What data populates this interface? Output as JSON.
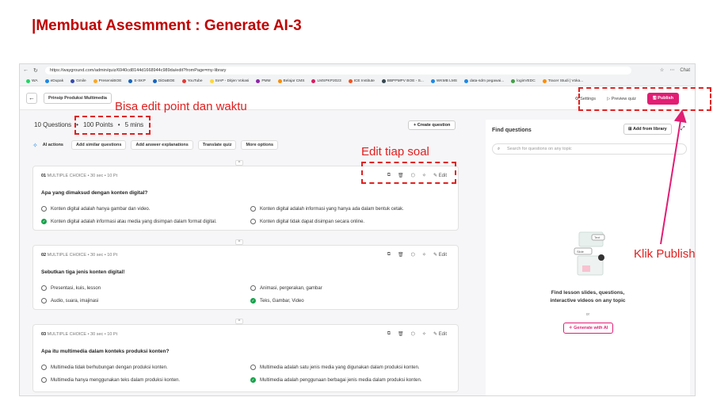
{
  "slide": {
    "title": "|Membuat Asesmment : Generate AI-3"
  },
  "browser": {
    "url": "https://wayground.com/admin/quiz/6940cd8144d1668944c989da/edit?fromPage=my-library",
    "profile_label": "Chat",
    "bookmarks": [
      "WA",
      "eDupak",
      "Gmile",
      "PresensiBOE",
      "E-SKP",
      "DiDaBOE",
      "YouTube",
      "SIAP - Ditjen Vokasi",
      "PMM",
      "Belajar CMS",
      "LMSPKP2023",
      "ICE Institute",
      "BBPPMPV BOE - S...",
      "WKMB LMS",
      "data-sdm pegawai...",
      "loginVEDC",
      "Tracer Studi | Voka..."
    ]
  },
  "appbar": {
    "quiz_name": "Prinsip Produksi Multimedia",
    "settings": "Settings",
    "preview": "Preview quiz",
    "publish": "Publish"
  },
  "summary": {
    "questions": "10 Questions",
    "points": "100 Points",
    "time": "5 mins",
    "create": "+ Create question"
  },
  "ai_actions": {
    "label": "AI actions",
    "items": [
      "Add similar questions",
      "Add answer explanations",
      "Translate quiz",
      "More options"
    ]
  },
  "questions": [
    {
      "meta_no": "01",
      "meta_type": "MULTIPLE CHOICE",
      "meta_time": "30 sec",
      "meta_pts": "10 Pt",
      "edit": "Edit",
      "text": "Apa yang dimaksud dengan konten digital?",
      "options": [
        "Konten digital adalah hanya gambar dan video.",
        "Konten digital adalah informasi yang hanya ada dalam bentuk cetak.",
        "Konten digital adalah informasi atau media yang disimpan dalam format digital.",
        "Konten digital tidak dapat disimpan secara online."
      ]
    },
    {
      "meta_no": "02",
      "meta_type": "MULTIPLE CHOICE",
      "meta_time": "30 sec",
      "meta_pts": "10 Pt",
      "edit": "Edit",
      "text": "Sebutkan tiga jenis konten digital!",
      "options": [
        "Presentasi, kuis, lesson",
        "Animasi, pergerakan, gambar",
        "Audio, suara, imajinasi",
        "Teks, Gambar, Video"
      ]
    },
    {
      "meta_no": "03",
      "meta_type": "MULTIPLE CHOICE",
      "meta_time": "30 sec",
      "meta_pts": "10 Pt",
      "edit": "Edit",
      "text": "Apa itu multimedia dalam konteks produksi konten?",
      "options": [
        "Multimedia tidak berhubungan dengan produksi konten.",
        "Multimedia adalah satu jenis media yang digunakan dalam produksi konten.",
        "Multimedia hanya menggunakan teks dalam produksi konten.",
        "Multimedia adalah penggunaan berbagai jenis media dalam produksi konten."
      ]
    }
  ],
  "side": {
    "title": "Find questions",
    "library": "Add from library",
    "search_placeholder": "Search for questions on any topic",
    "promo": "Find lesson slides, questions,",
    "promo2": "interactive videos on any topic",
    "or": "or",
    "generate": "Generate with AI",
    "illus_text1": "Text",
    "illus_text2": "Slide"
  },
  "annotations": {
    "edit_points": "Bisa edit point dan waktu",
    "edit_each": "Edit tiap soal",
    "publish": "Klik Publish"
  },
  "colors": {
    "accent": "#e11d74",
    "callout": "#e02020",
    "correct": "#16a34a"
  }
}
